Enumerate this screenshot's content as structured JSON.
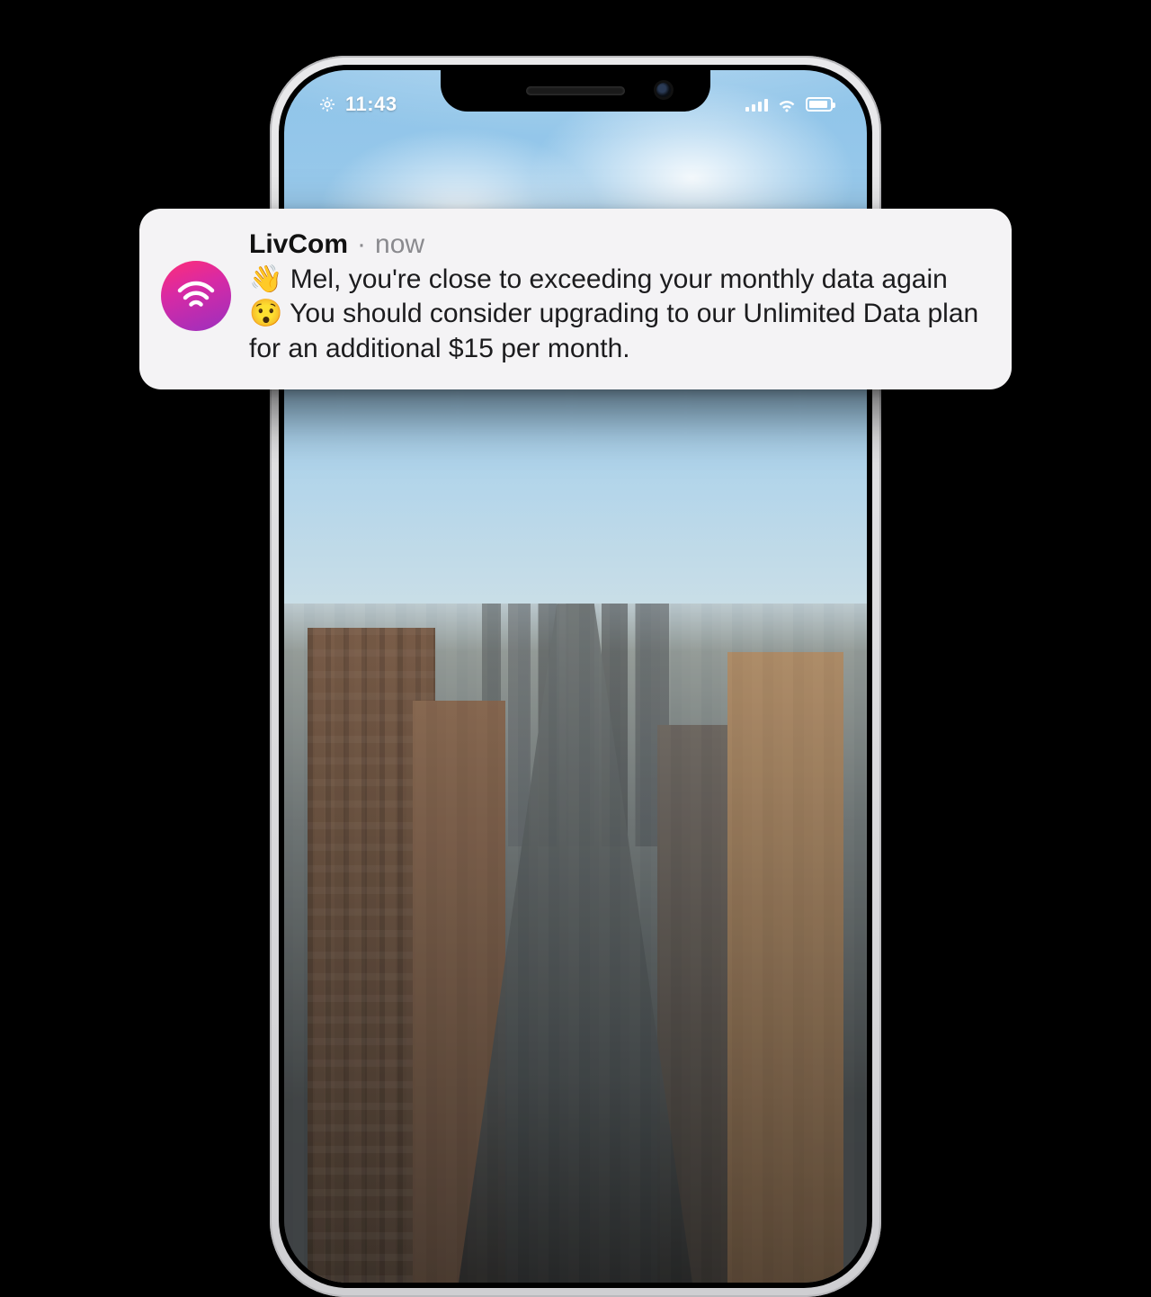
{
  "status": {
    "time": "11:43"
  },
  "notification": {
    "app_name": "LivCom",
    "separator": "·",
    "timestamp": "now",
    "body": "👋 Mel, you're close to exceeding your monthly data again 😯 You should consider upgrading to our Unlimited Data plan for an additional $15 per month."
  }
}
